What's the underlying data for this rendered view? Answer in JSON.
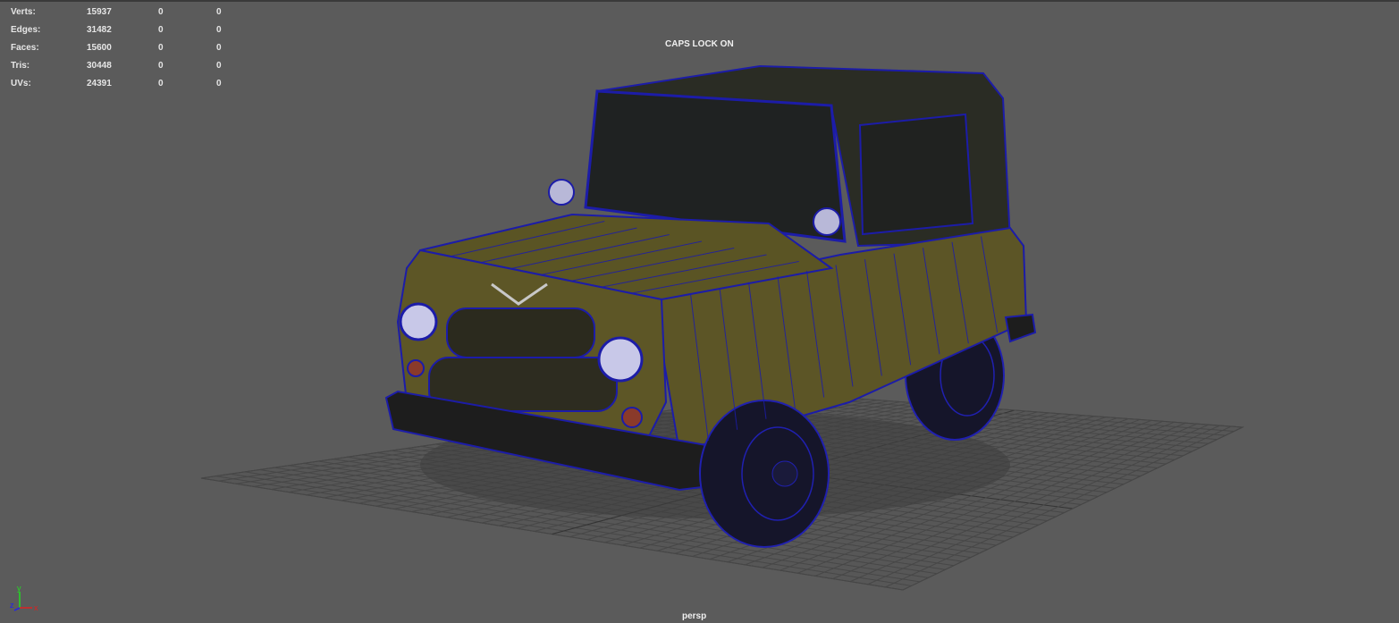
{
  "hud": {
    "rows": [
      {
        "label": "Verts:",
        "total": "15937",
        "selected": "0",
        "selected2": "0"
      },
      {
        "label": "Edges:",
        "total": "31482",
        "selected": "0",
        "selected2": "0"
      },
      {
        "label": "Faces:",
        "total": "15600",
        "selected": "0",
        "selected2": "0"
      },
      {
        "label": "Tris:",
        "total": "30448",
        "selected": "0",
        "selected2": "0"
      },
      {
        "label": "UVs:",
        "total": "24391",
        "selected": "0",
        "selected2": "0"
      }
    ]
  },
  "caps_lock": "CAPS LOCK ON",
  "camera_name": "persp",
  "axis": {
    "x": "x",
    "y": "y",
    "z": "z"
  },
  "colors": {
    "background": "#5b5b5b",
    "wireframe": "#1c1ca8",
    "body": "#5c5526",
    "grid": "#4a4a4a"
  }
}
